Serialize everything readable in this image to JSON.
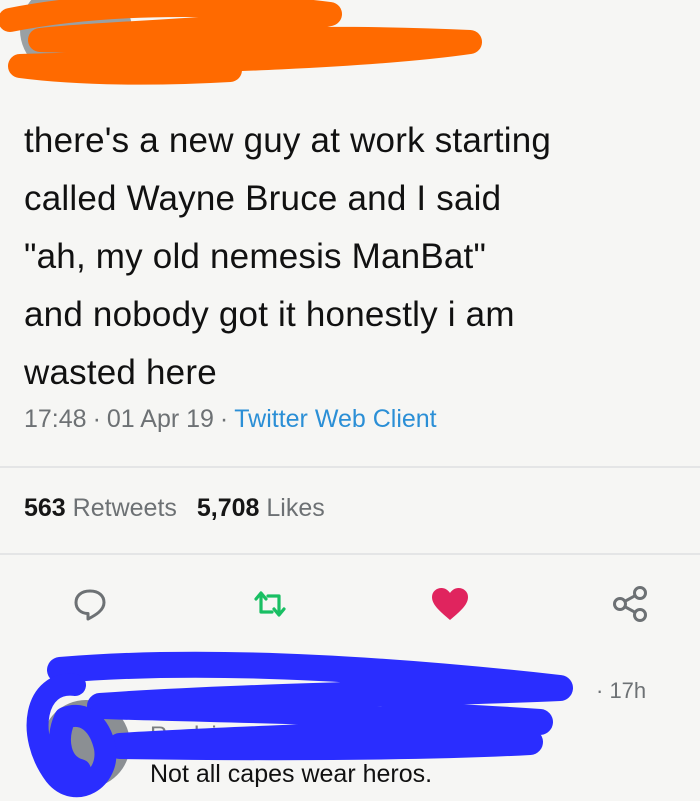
{
  "author": {
    "handle_fragment": "@"
  },
  "tweet": {
    "lines": [
      "there's a new guy at work starting",
      "called Wayne Bruce and I said",
      "\"ah, my old nemesis ManBat\"",
      "and nobody got it honestly i am",
      "wasted here"
    ],
    "time": "17:48",
    "date": "01 Apr 19",
    "client": "Twitter Web Client"
  },
  "stats": {
    "retweets_count": "563",
    "retweets_label": "Retweets",
    "likes_count": "5,708",
    "likes_label": "Likes"
  },
  "actions": {
    "reply_icon": "speech-bubble-icon",
    "retweet_icon": "retweet-icon",
    "like_icon": "heart-icon",
    "share_icon": "share-icon"
  },
  "reply": {
    "time": "· 17h",
    "replying_to": "Replying to",
    "text": "Not all capes wear heros."
  },
  "colors": {
    "link": "#2b8fd6",
    "retweet": "#19bf63",
    "like": "#e0245e",
    "redact_top": "#ff6a00",
    "redact_bottom": "#2a2dff"
  }
}
